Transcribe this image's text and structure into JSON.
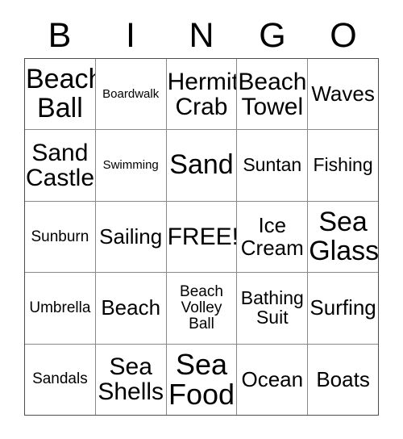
{
  "card": {
    "title": "BINGO",
    "header_letters": [
      "B",
      "I",
      "N",
      "G",
      "O"
    ],
    "free_space_label": "FREE!",
    "colors": {
      "background": "#ffffff",
      "text": "#000000",
      "grid_line": "#8a8a8a",
      "outer_border": "#4d4d4d"
    },
    "grid": {
      "columns": 5,
      "rows": 5,
      "cells": [
        [
          {
            "label": "Beach\nBall",
            "size": "xl"
          },
          {
            "label": "Boardwalk",
            "size": "xxs"
          },
          {
            "label": "Hermit\nCrab",
            "size": "l"
          },
          {
            "label": "Beach\nTowel",
            "size": "l"
          },
          {
            "label": "Waves",
            "size": "m"
          }
        ],
        [
          {
            "label": "Sand\nCastle",
            "size": "l"
          },
          {
            "label": "Swimming",
            "size": "xxs"
          },
          {
            "label": "Sand",
            "size": "xl"
          },
          {
            "label": "Suntan",
            "size": "s"
          },
          {
            "label": "Fishing",
            "size": "s"
          }
        ],
        [
          {
            "label": "Sunburn",
            "size": "xs"
          },
          {
            "label": "Sailing",
            "size": "m"
          },
          {
            "label": "FREE!",
            "size": "l"
          },
          {
            "label": "Ice\nCream",
            "size": "m"
          },
          {
            "label": "Sea\nGlass",
            "size": "xl"
          }
        ],
        [
          {
            "label": "Umbrella",
            "size": "xs"
          },
          {
            "label": "Beach",
            "size": "m"
          },
          {
            "label": "Beach\nVolley\nBall",
            "size": "xs"
          },
          {
            "label": "Bathing\nSuit",
            "size": "s"
          },
          {
            "label": "Surfing",
            "size": "m"
          }
        ],
        [
          {
            "label": "Sandals",
            "size": "xs"
          },
          {
            "label": "Sea\nShells",
            "size": "l"
          },
          {
            "label": "Sea\nFood",
            "size": "xxl"
          },
          {
            "label": "Ocean",
            "size": "m"
          },
          {
            "label": "Boats",
            "size": "m"
          }
        ]
      ]
    }
  }
}
